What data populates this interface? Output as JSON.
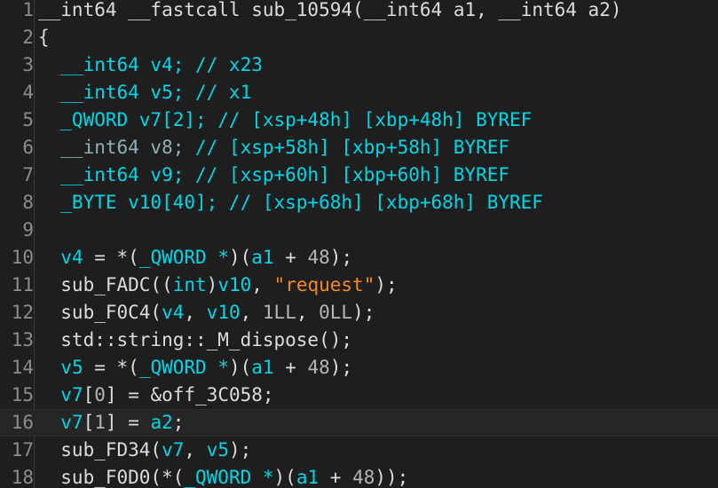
{
  "line_numbers": [
    "1",
    "2",
    "3",
    "4",
    "5",
    "6",
    "7",
    "8",
    "9",
    "10",
    "11",
    "12",
    "13",
    "14",
    "15",
    "16",
    "17",
    "18"
  ],
  "lines": [
    [
      {
        "t": "__int64 __fastcall ",
        "c": "fn"
      },
      {
        "t": "sub_10594",
        "c": "fn"
      },
      {
        "t": "(",
        "c": "pun"
      },
      {
        "t": "__int64 a1",
        "c": "fn"
      },
      {
        "t": ", ",
        "c": "pun"
      },
      {
        "t": "__int64 a2",
        "c": "fn"
      },
      {
        "t": ")",
        "c": "pun"
      }
    ],
    [
      {
        "t": "{",
        "c": "pun"
      }
    ],
    [
      {
        "t": "  __int64 v4; // x23",
        "c": "cm"
      }
    ],
    [
      {
        "t": "  __int64 v5; // x1",
        "c": "cm"
      }
    ],
    [
      {
        "t": "  _QWORD v7[2]; // [xsp+48h] [xbp+48h] BYREF",
        "c": "cm"
      }
    ],
    [
      {
        "t": "  __int64 v8; ",
        "c": "dim"
      },
      {
        "t": "// [xsp+58h] [xbp+58h] BYREF",
        "c": "cm"
      }
    ],
    [
      {
        "t": "  __int64 v9; // [xsp+60h] [xbp+60h] BYREF",
        "c": "cm"
      }
    ],
    [
      {
        "t": "  _BYTE v10[40]; // [xsp+68h] [xbp+68h] BYREF",
        "c": "cm"
      }
    ],
    [
      {
        "t": "",
        "c": "pun"
      }
    ],
    [
      {
        "t": "  ",
        "c": "pun"
      },
      {
        "t": "v4",
        "c": "var"
      },
      {
        "t": " = *(",
        "c": "pun"
      },
      {
        "t": "_QWORD *",
        "c": "ty"
      },
      {
        "t": ")(",
        "c": "pun"
      },
      {
        "t": "a1",
        "c": "var"
      },
      {
        "t": " + ",
        "c": "pun"
      },
      {
        "t": "48",
        "c": "num"
      },
      {
        "t": ");",
        "c": "pun"
      }
    ],
    [
      {
        "t": "  sub_FADC((",
        "c": "fn"
      },
      {
        "t": "int",
        "c": "kw"
      },
      {
        "t": ")",
        "c": "pun"
      },
      {
        "t": "v10",
        "c": "var"
      },
      {
        "t": ", ",
        "c": "pun"
      },
      {
        "t": "\"request\"",
        "c": "str"
      },
      {
        "t": ");",
        "c": "pun"
      }
    ],
    [
      {
        "t": "  sub_F0C4(",
        "c": "fn"
      },
      {
        "t": "v4",
        "c": "var"
      },
      {
        "t": ", ",
        "c": "pun"
      },
      {
        "t": "v10",
        "c": "var"
      },
      {
        "t": ", ",
        "c": "pun"
      },
      {
        "t": "1LL",
        "c": "num"
      },
      {
        "t": ", ",
        "c": "pun"
      },
      {
        "t": "0LL",
        "c": "num"
      },
      {
        "t": ");",
        "c": "pun"
      }
    ],
    [
      {
        "t": "  std::string::_M_dispose();",
        "c": "fn"
      }
    ],
    [
      {
        "t": "  ",
        "c": "pun"
      },
      {
        "t": "v5",
        "c": "var"
      },
      {
        "t": " = *(",
        "c": "pun"
      },
      {
        "t": "_QWORD *",
        "c": "ty"
      },
      {
        "t": ")(",
        "c": "pun"
      },
      {
        "t": "a1",
        "c": "var"
      },
      {
        "t": " + ",
        "c": "pun"
      },
      {
        "t": "48",
        "c": "num"
      },
      {
        "t": ");",
        "c": "pun"
      }
    ],
    [
      {
        "t": "  ",
        "c": "pun"
      },
      {
        "t": "v7",
        "c": "var"
      },
      {
        "t": "[",
        "c": "pun"
      },
      {
        "t": "0",
        "c": "num"
      },
      {
        "t": "] = &off_3C058;",
        "c": "pun"
      }
    ],
    [
      {
        "t": "  ",
        "c": "pun"
      },
      {
        "t": "v7",
        "c": "var"
      },
      {
        "t": "[",
        "c": "pun"
      },
      {
        "t": "1",
        "c": "num"
      },
      {
        "t": "] = ",
        "c": "pun"
      },
      {
        "t": "a2",
        "c": "var"
      },
      {
        "t": ";",
        "c": "pun"
      }
    ],
    [
      {
        "t": "  sub_FD34(",
        "c": "fn"
      },
      {
        "t": "v7",
        "c": "var"
      },
      {
        "t": ", ",
        "c": "pun"
      },
      {
        "t": "v5",
        "c": "var"
      },
      {
        "t": ");",
        "c": "pun"
      }
    ],
    [
      {
        "t": "  sub_F0D0(*(",
        "c": "fn"
      },
      {
        "t": "_QWORD *",
        "c": "ty"
      },
      {
        "t": ")(",
        "c": "pun"
      },
      {
        "t": "a1",
        "c": "var"
      },
      {
        "t": " + ",
        "c": "pun"
      },
      {
        "t": "48",
        "c": "num"
      },
      {
        "t": "));",
        "c": "pun"
      }
    ]
  ],
  "current_line": "16",
  "colors": {
    "background": "#1e1e1e",
    "identifier": "#00d6e6",
    "string": "#f48a1b",
    "text": "#dcdcdc"
  }
}
